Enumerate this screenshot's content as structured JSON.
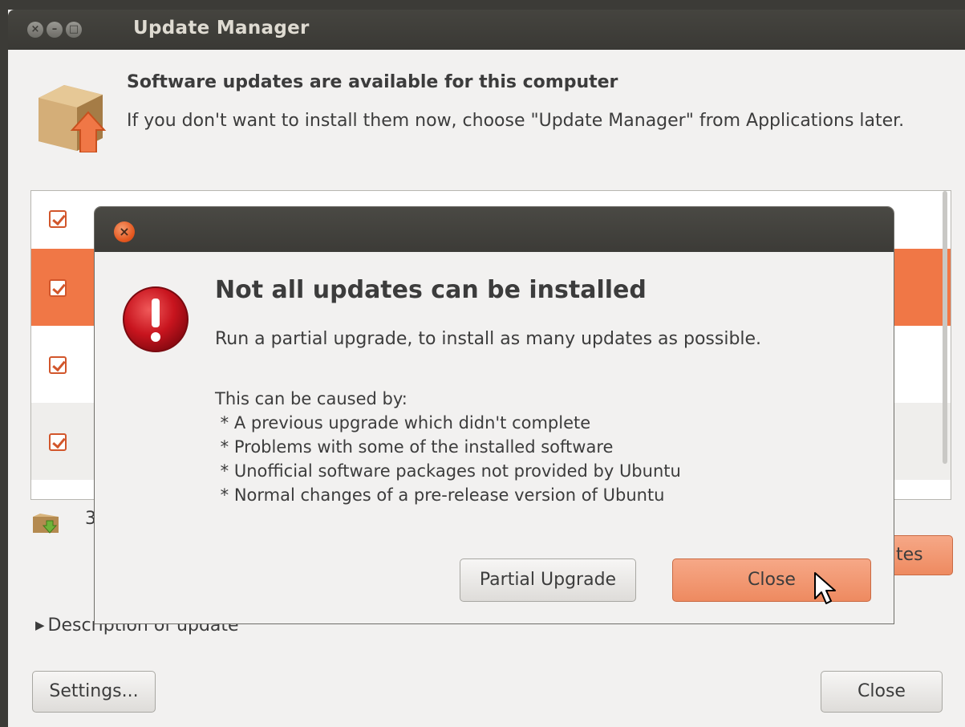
{
  "window": {
    "title": "Update Manager",
    "close_glyph": "×",
    "minimize_glyph": "–",
    "maximize_glyph": "□"
  },
  "header": {
    "heading": "Software updates are available for this computer",
    "subtext": "If you don't want to install them now, choose \"Update Manager\" from Applications later."
  },
  "update_list": {
    "rows": [
      {
        "checked": true
      },
      {
        "checked": true,
        "selected": true
      },
      {
        "checked": true
      },
      {
        "checked": true
      }
    ]
  },
  "status": {
    "count_text": "3"
  },
  "buttons": {
    "install_label": "lates",
    "settings_label": "Settings...",
    "close_label": "Close"
  },
  "description_expander": {
    "arrow": "▶",
    "label": "Description of update"
  },
  "dialog": {
    "close_glyph": "×",
    "heading": "Not all updates can be installed",
    "text": "Run a partial upgrade, to install as many updates as possible.",
    "causes": "This can be caused by:\n * A previous upgrade which didn't complete\n * Problems with some of the installed software\n * Unofficial software packages not provided by Ubuntu\n * Normal changes of a pre-release version of Ubuntu",
    "partial_upgrade_label": "Partial Upgrade",
    "close_label": "Close"
  },
  "colors": {
    "accent": "#f07746",
    "button_highlight": "#ee8a60",
    "titlebar": "#3c3b37",
    "window_bg": "#f2f1f0",
    "error_red": "#c0121c"
  },
  "icons": {
    "package": "package-upgrade-icon",
    "error": "error-icon",
    "download": "download-icon",
    "cursor": "mouse-pointer-icon"
  }
}
